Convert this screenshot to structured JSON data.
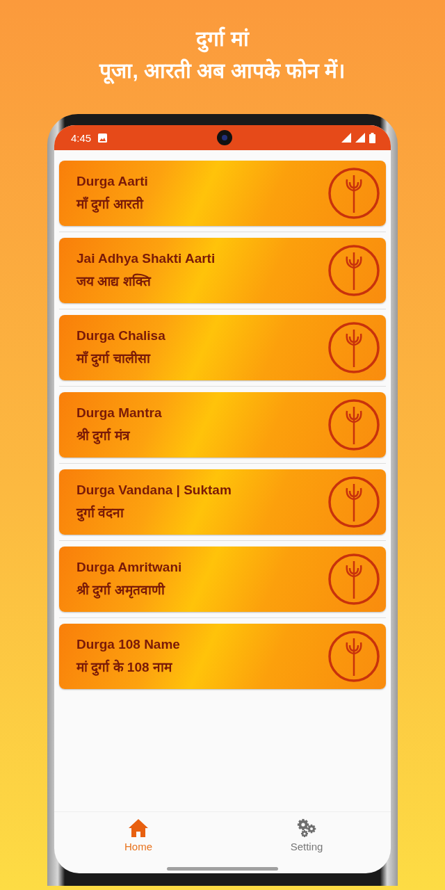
{
  "headline": {
    "line_1": "दुर्गा मां",
    "line_2": "पूजा, आरती अब आपके फोन में।"
  },
  "status_bar": {
    "time": "4:45"
  },
  "cards": [
    {
      "title": "Durga Aarti",
      "subtitle": "माँ दुर्गा आरती"
    },
    {
      "title": "Jai Adhya Shakti Aarti",
      "subtitle": "जय आद्य शक्ति"
    },
    {
      "title": "Durga Chalisa",
      "subtitle": "माँ दुर्गा चालीसा"
    },
    {
      "title": "Durga Mantra",
      "subtitle": "श्री दुर्गा मंत्र"
    },
    {
      "title": "Durga Vandana | Suktam",
      "subtitle": "दुर्गा वंदना"
    },
    {
      "title": "Durga Amritwani",
      "subtitle": "श्री दुर्गा अमृतवाणी"
    },
    {
      "title": "Durga 108 Name",
      "subtitle": "मां दुर्गा के 108 नाम"
    }
  ],
  "bottom_nav": [
    {
      "kind": "home",
      "label": "Home",
      "selected": true
    },
    {
      "kind": "settings",
      "label": "Setting",
      "selected": false
    }
  ]
}
